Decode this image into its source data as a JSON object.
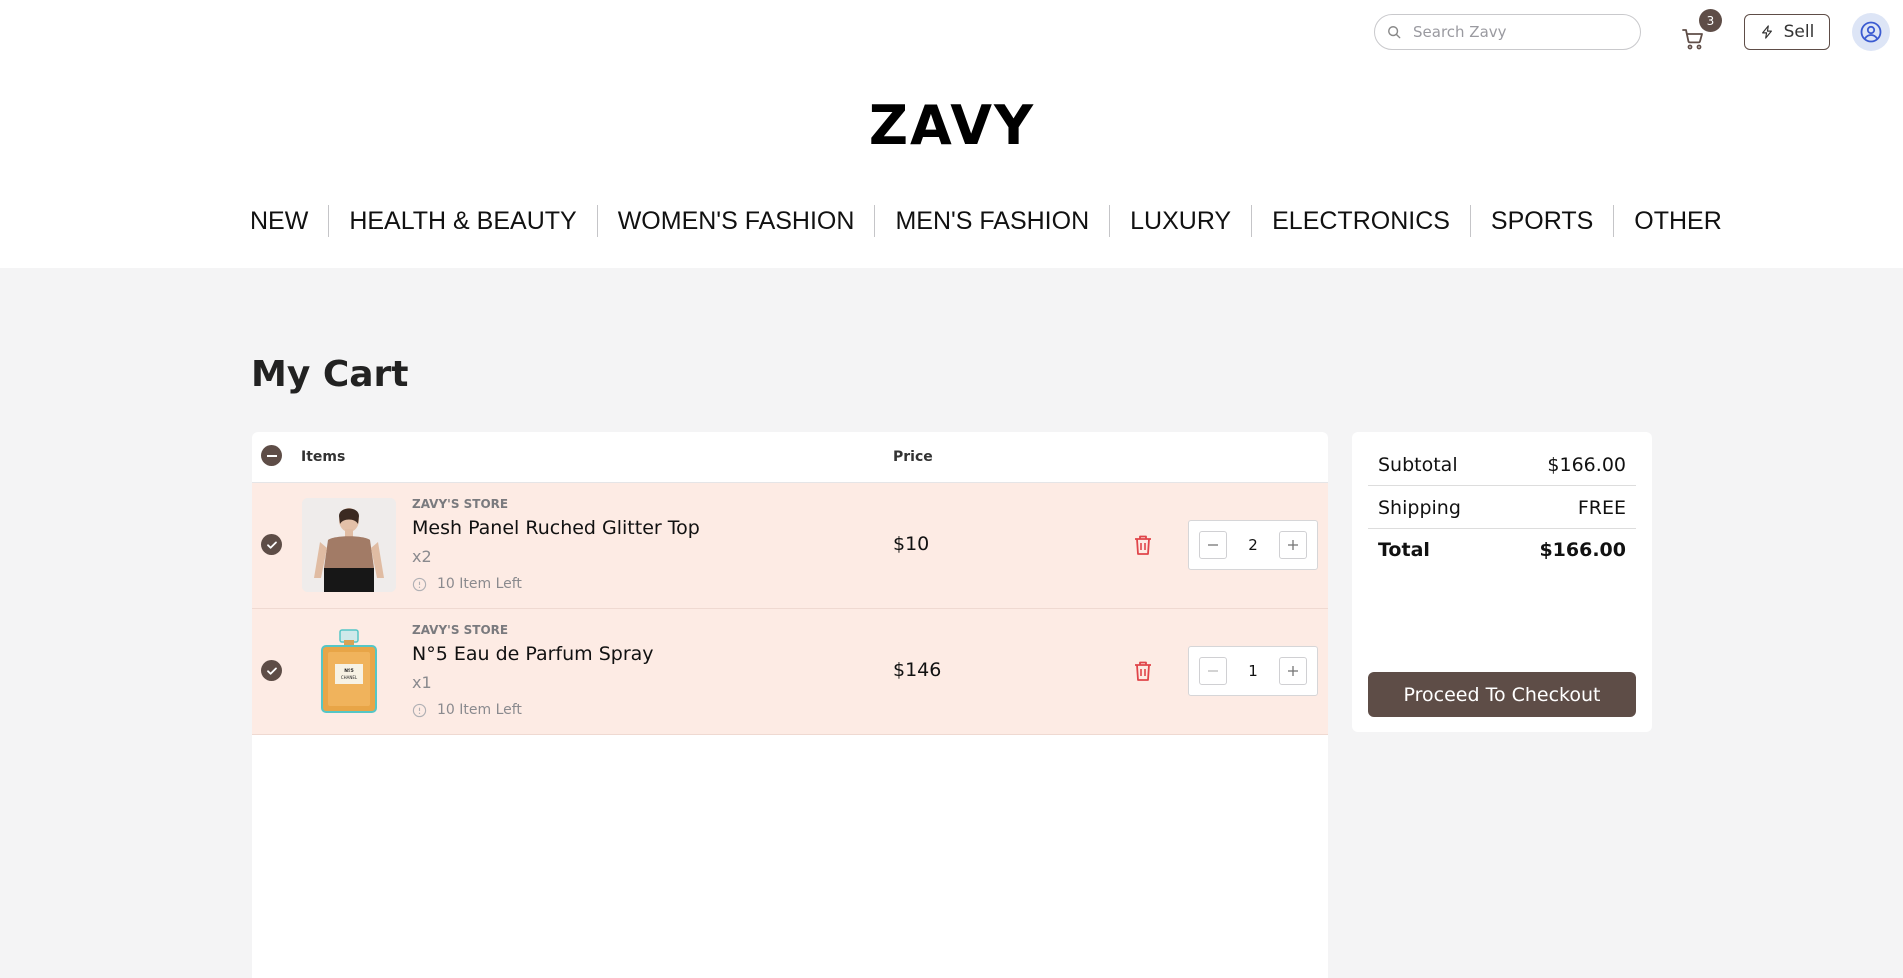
{
  "header": {
    "search_placeholder": "Search Zavy",
    "cart_count": "3",
    "sell_label": "Sell",
    "logo_text": "ZAVY"
  },
  "nav": [
    {
      "label": "NEW"
    },
    {
      "label": "HEALTH & BEAUTY"
    },
    {
      "label": "WOMEN'S FASHION"
    },
    {
      "label": "MEN'S FASHION"
    },
    {
      "label": "LUXURY"
    },
    {
      "label": "ELECTRONICS"
    },
    {
      "label": "SPORTS"
    },
    {
      "label": "OTHER"
    }
  ],
  "page_title": "My Cart",
  "cart": {
    "col_items": "Items",
    "col_price": "Price",
    "items": [
      {
        "store": "ZAVY'S STORE",
        "name": "Mesh Panel Ruched Glitter Top",
        "qty_text": "x2",
        "stock": "10 Item Left",
        "price": "$10",
        "quantity": "2"
      },
      {
        "store": "ZAVY'S STORE",
        "name": "N°5 Eau de Parfum Spray",
        "qty_text": "x1",
        "stock": "10 Item Left",
        "price": "$146",
        "quantity": "1"
      }
    ]
  },
  "summary": {
    "subtotal_label": "Subtotal",
    "subtotal_value": "$166.00",
    "shipping_label": "Shipping",
    "shipping_value": "FREE",
    "total_label": "Total",
    "total_value": "$166.00",
    "checkout_label": "Proceed To Checkout"
  },
  "colors": {
    "brand": "#5e4d47",
    "row_bg": "#fdebe4",
    "trash": "#e0454a"
  }
}
